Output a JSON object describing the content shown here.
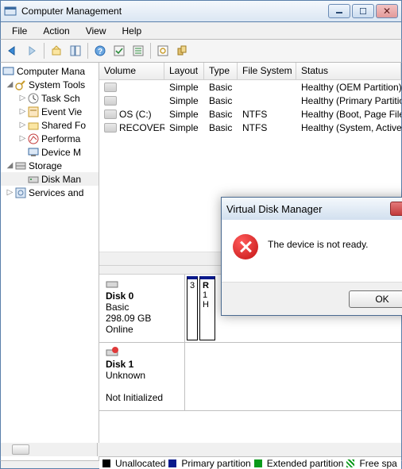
{
  "window": {
    "title": "Computer Management"
  },
  "menu": {
    "file": "File",
    "action": "Action",
    "view": "View",
    "help": "Help"
  },
  "tree": {
    "root": "Computer Mana",
    "systools": "System Tools",
    "tasksch": "Task Sch",
    "eventvi": "Event Vie",
    "sharedfo": "Shared Fo",
    "performa": "Performa",
    "devicem": "Device M",
    "storage": "Storage",
    "diskman": "Disk Man",
    "services": "Services and"
  },
  "columns": {
    "volume": "Volume",
    "layout": "Layout",
    "type": "Type",
    "filesystem": "File System",
    "status": "Status"
  },
  "volumes": [
    {
      "name": "",
      "layout": "Simple",
      "type": "Basic",
      "fs": "",
      "status": "Healthy (OEM Partition)"
    },
    {
      "name": "",
      "layout": "Simple",
      "type": "Basic",
      "fs": "",
      "status": "Healthy (Primary Partitio"
    },
    {
      "name": "OS (C:)",
      "layout": "Simple",
      "type": "Basic",
      "fs": "NTFS",
      "status": "Healthy (Boot, Page File,"
    },
    {
      "name": "RECOVERY",
      "layout": "Simple",
      "type": "Basic",
      "fs": "NTFS",
      "status": "Healthy (System, Active,"
    }
  ],
  "disks": {
    "d0": {
      "title": "Disk 0",
      "type": "Basic",
      "size": "298.09 GB",
      "status": "Online"
    },
    "d1": {
      "title": "Disk 1",
      "type": "Unknown",
      "status": "Not Initialized"
    },
    "part0": {
      "size": "3",
      "label": "R",
      "line2": "1",
      "line3": "H"
    }
  },
  "legend": {
    "unalloc": "Unallocated",
    "primary": "Primary partition",
    "extended": "Extended partition",
    "freesp": "Free spa"
  },
  "dialog": {
    "title": "Virtual Disk Manager",
    "message": "The device is not ready.",
    "ok": "OK"
  }
}
